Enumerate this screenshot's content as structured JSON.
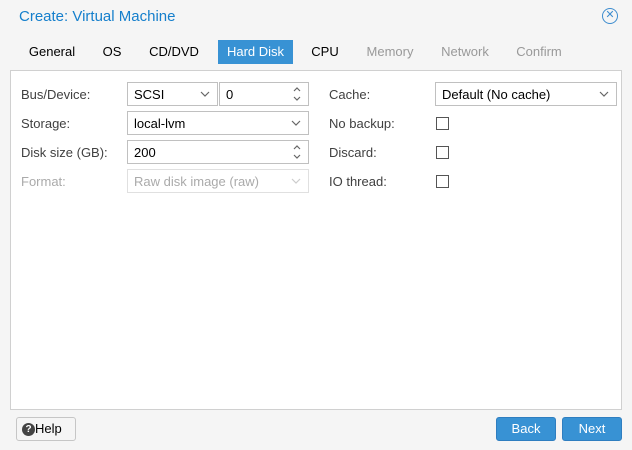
{
  "window": {
    "title": "Create: Virtual Machine"
  },
  "tabs": [
    {
      "label": "General",
      "state": "normal"
    },
    {
      "label": "OS",
      "state": "normal"
    },
    {
      "label": "CD/DVD",
      "state": "normal"
    },
    {
      "label": "Hard Disk",
      "state": "active"
    },
    {
      "label": "CPU",
      "state": "normal"
    },
    {
      "label": "Memory",
      "state": "disabled"
    },
    {
      "label": "Network",
      "state": "disabled"
    },
    {
      "label": "Confirm",
      "state": "disabled"
    }
  ],
  "form": {
    "bus_device": {
      "label": "Bus/Device:",
      "bus_value": "SCSI",
      "device_value": "0"
    },
    "storage": {
      "label": "Storage:",
      "value": "local-lvm"
    },
    "disk_size": {
      "label": "Disk size (GB):",
      "value": "200"
    },
    "format": {
      "label": "Format:",
      "value": "Raw disk image (raw)"
    },
    "cache": {
      "label": "Cache:",
      "value": "Default (No cache)"
    },
    "no_backup": {
      "label": "No backup:",
      "checked": false
    },
    "discard": {
      "label": "Discard:",
      "checked": false
    },
    "io_thread": {
      "label": "IO thread:",
      "checked": false
    }
  },
  "footer": {
    "help_label": "Help",
    "back_label": "Back",
    "next_label": "Next"
  },
  "colors": {
    "accent": "#3892d4",
    "title": "#157fcc"
  },
  "icons": {
    "close": "close-icon",
    "help": "help-icon",
    "dropdown": "chevron-down-icon",
    "spinner": "spinner-icon"
  }
}
